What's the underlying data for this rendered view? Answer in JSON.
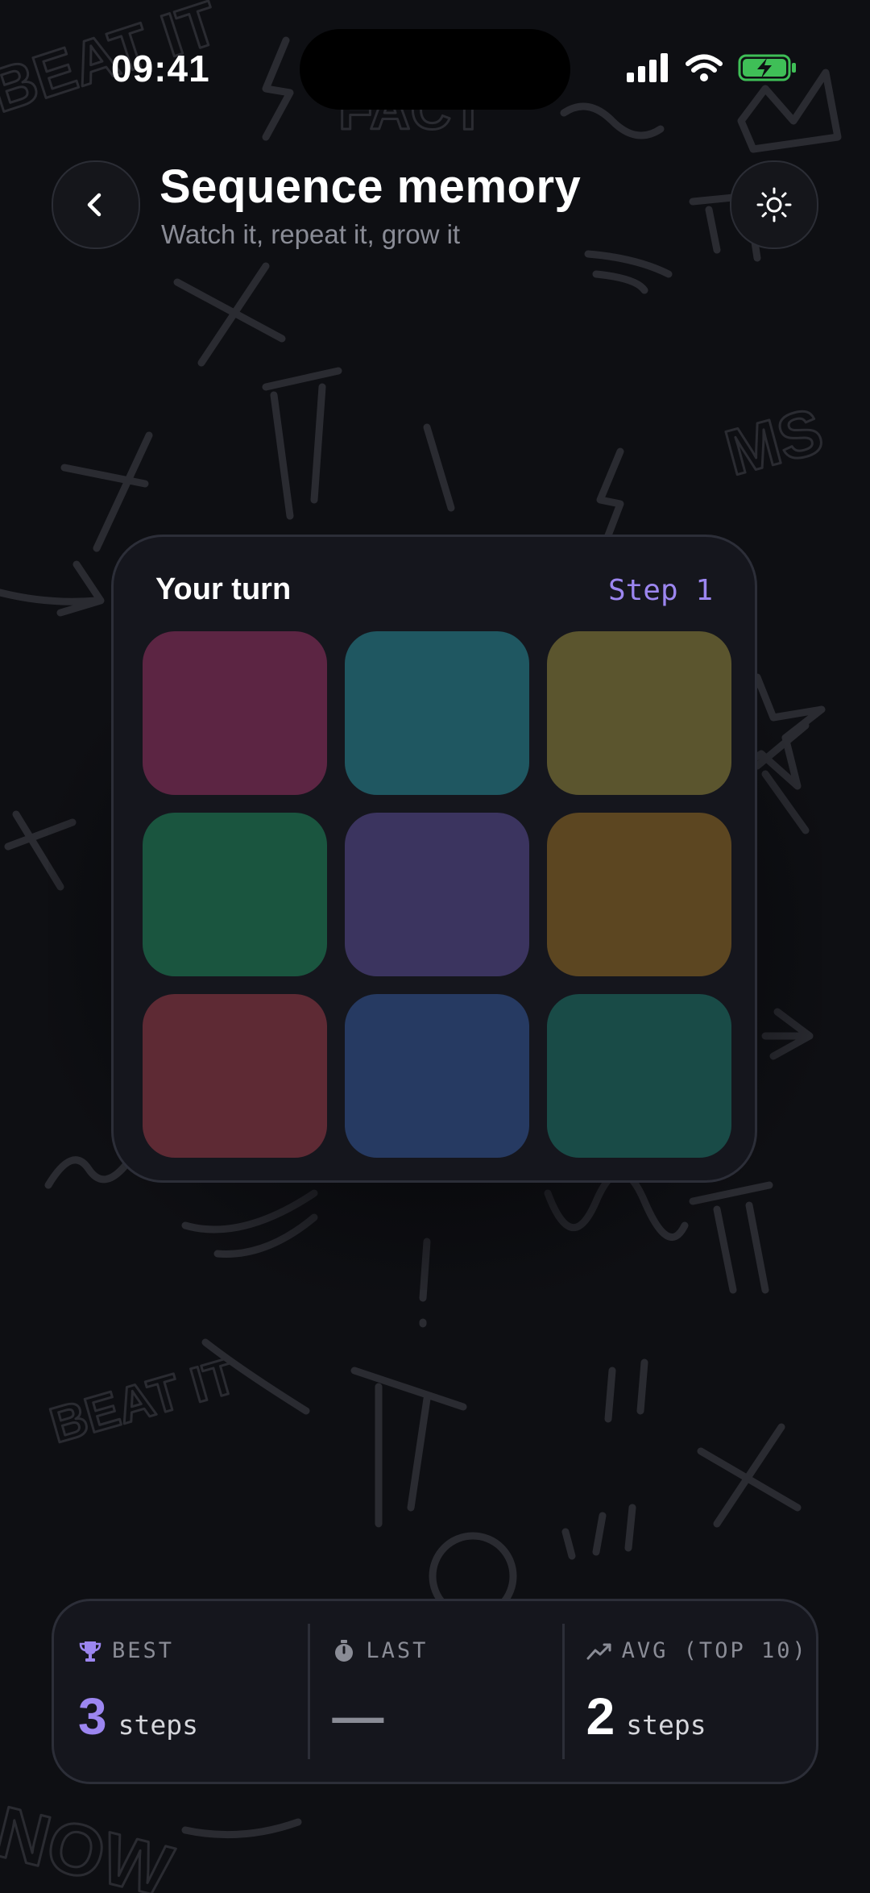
{
  "status_bar": {
    "time": "09:41"
  },
  "header": {
    "title": "Sequence memory",
    "subtitle": "Watch it, repeat it, grow it",
    "back_icon": "chevron-left-icon",
    "theme_icon": "sun-icon"
  },
  "game": {
    "turn_label": "Your turn",
    "step_label": "Step 1",
    "tiles": [
      {
        "color": "#5c2543"
      },
      {
        "color": "#1f5761"
      },
      {
        "color": "#5b552e"
      },
      {
        "color": "#1a553f"
      },
      {
        "color": "#3b345f"
      },
      {
        "color": "#5c4621"
      },
      {
        "color": "#5e2a34"
      },
      {
        "color": "#263a62"
      },
      {
        "color": "#194b47"
      }
    ]
  },
  "stats": [
    {
      "label": "BEST",
      "value": "3",
      "unit": "steps",
      "icon": "trophy-icon",
      "value_color": "#9c86f0"
    },
    {
      "label": "LAST",
      "value": "—",
      "unit": "",
      "icon": "stopwatch-icon",
      "value_color": "#8a8c96"
    },
    {
      "label": "AVG (TOP 10)",
      "value": "2",
      "unit": "steps",
      "icon": "trend-icon",
      "value_color": "#ffffff"
    }
  ],
  "background_doodle_text": [
    "BEAT IT",
    "FACT",
    "MS",
    "BEAT IT",
    "NOW"
  ],
  "colors": {
    "accent": "#9c86f0",
    "background": "#0e0f13"
  }
}
